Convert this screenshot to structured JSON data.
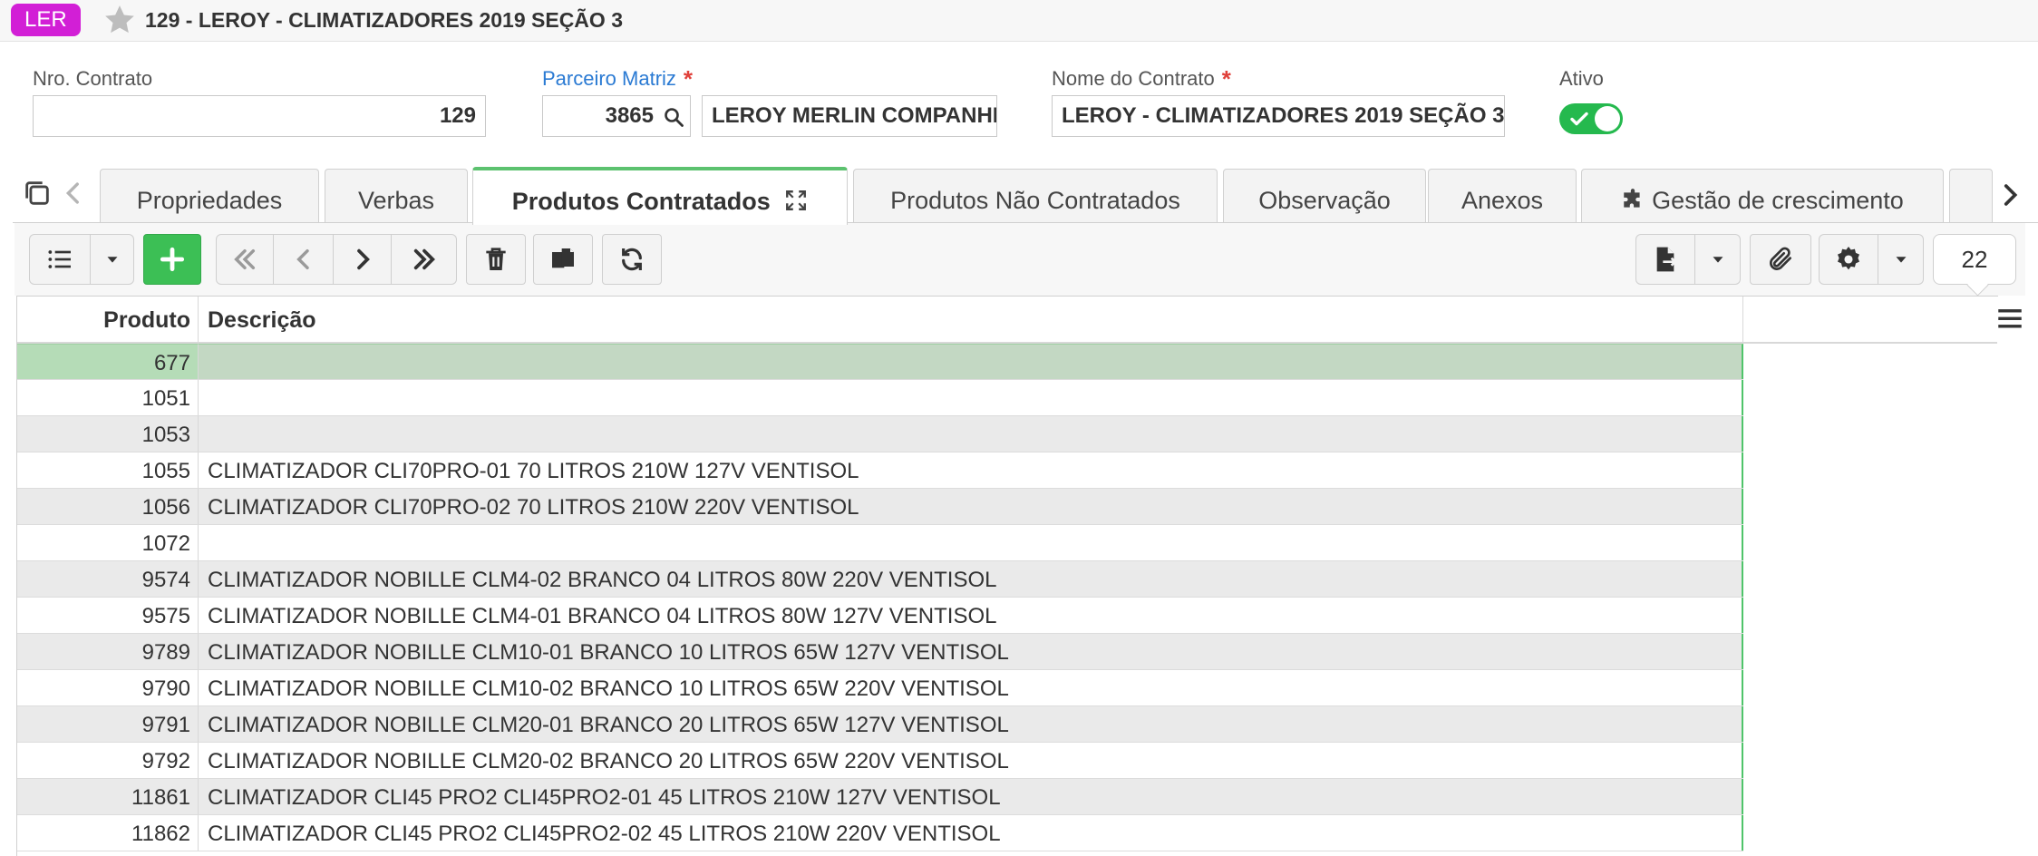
{
  "header": {
    "app_badge": "LER",
    "title": "129 - LEROY - CLIMATIZADORES 2019 SEÇÃO 3"
  },
  "form": {
    "nro_contrato": {
      "label": "Nro. Contrato",
      "value": "129"
    },
    "parceiro_matriz": {
      "label": "Parceiro Matriz",
      "code": "3865",
      "name": "LEROY MERLIN COMPANHIA BRASILEIRA"
    },
    "nome_contrato": {
      "label": "Nome do Contrato",
      "value": "LEROY - CLIMATIZADORES 2019 SEÇÃO 3"
    },
    "ativo": {
      "label": "Ativo",
      "checked": true
    },
    "required_mark": "*"
  },
  "tabs": [
    {
      "label": "Propriedades"
    },
    {
      "label": "Verbas"
    },
    {
      "label": "Produtos Contratados",
      "active": true
    },
    {
      "label": "Produtos Não Contratados"
    },
    {
      "label": "Observação"
    },
    {
      "label": "Anexos"
    },
    {
      "label": "Gestão de crescimento"
    }
  ],
  "toolbar": {
    "record_count": "22"
  },
  "grid": {
    "columns": {
      "produto": "Produto",
      "descricao": "Descrição"
    },
    "rows": [
      {
        "produto": "677",
        "descricao": "",
        "selected": true
      },
      {
        "produto": "1051",
        "descricao": ""
      },
      {
        "produto": "1053",
        "descricao": ""
      },
      {
        "produto": "1055",
        "descricao": "CLIMATIZADOR CLI70PRO-01 70 LITROS 210W 127V VENTISOL"
      },
      {
        "produto": "1056",
        "descricao": "CLIMATIZADOR CLI70PRO-02 70 LITROS 210W 220V VENTISOL"
      },
      {
        "produto": "1072",
        "descricao": ""
      },
      {
        "produto": "9574",
        "descricao": "CLIMATIZADOR NOBILLE CLM4-02 BRANCO 04 LITROS 80W 220V VENTISOL"
      },
      {
        "produto": "9575",
        "descricao": "CLIMATIZADOR NOBILLE CLM4-01 BRANCO 04 LITROS 80W 127V VENTISOL"
      },
      {
        "produto": "9789",
        "descricao": "CLIMATIZADOR NOBILLE CLM10-01 BRANCO 10 LITROS 65W 127V VENTISOL"
      },
      {
        "produto": "9790",
        "descricao": "CLIMATIZADOR NOBILLE CLM10-02 BRANCO 10 LITROS 65W 220V VENTISOL"
      },
      {
        "produto": "9791",
        "descricao": "CLIMATIZADOR NOBILLE CLM20-01 BRANCO 20 LITROS 65W 127V VENTISOL"
      },
      {
        "produto": "9792",
        "descricao": "CLIMATIZADOR NOBILLE CLM20-02 BRANCO 20 LITROS 65W 220V VENTISOL"
      },
      {
        "produto": "11861",
        "descricao": "CLIMATIZADOR CLI45 PRO2 CLI45PRO2-01 45 LITROS 210W 127V VENTISOL"
      },
      {
        "produto": "11862",
        "descricao": "CLIMATIZADOR CLI45 PRO2 CLI45PRO2-02 45 LITROS 210W 220V VENTISOL"
      }
    ]
  },
  "colors": {
    "accent_green": "#3cbf55",
    "badge_magenta": "#d21fd6",
    "link_blue": "#2a7ad3",
    "required_red": "#e0403a"
  }
}
